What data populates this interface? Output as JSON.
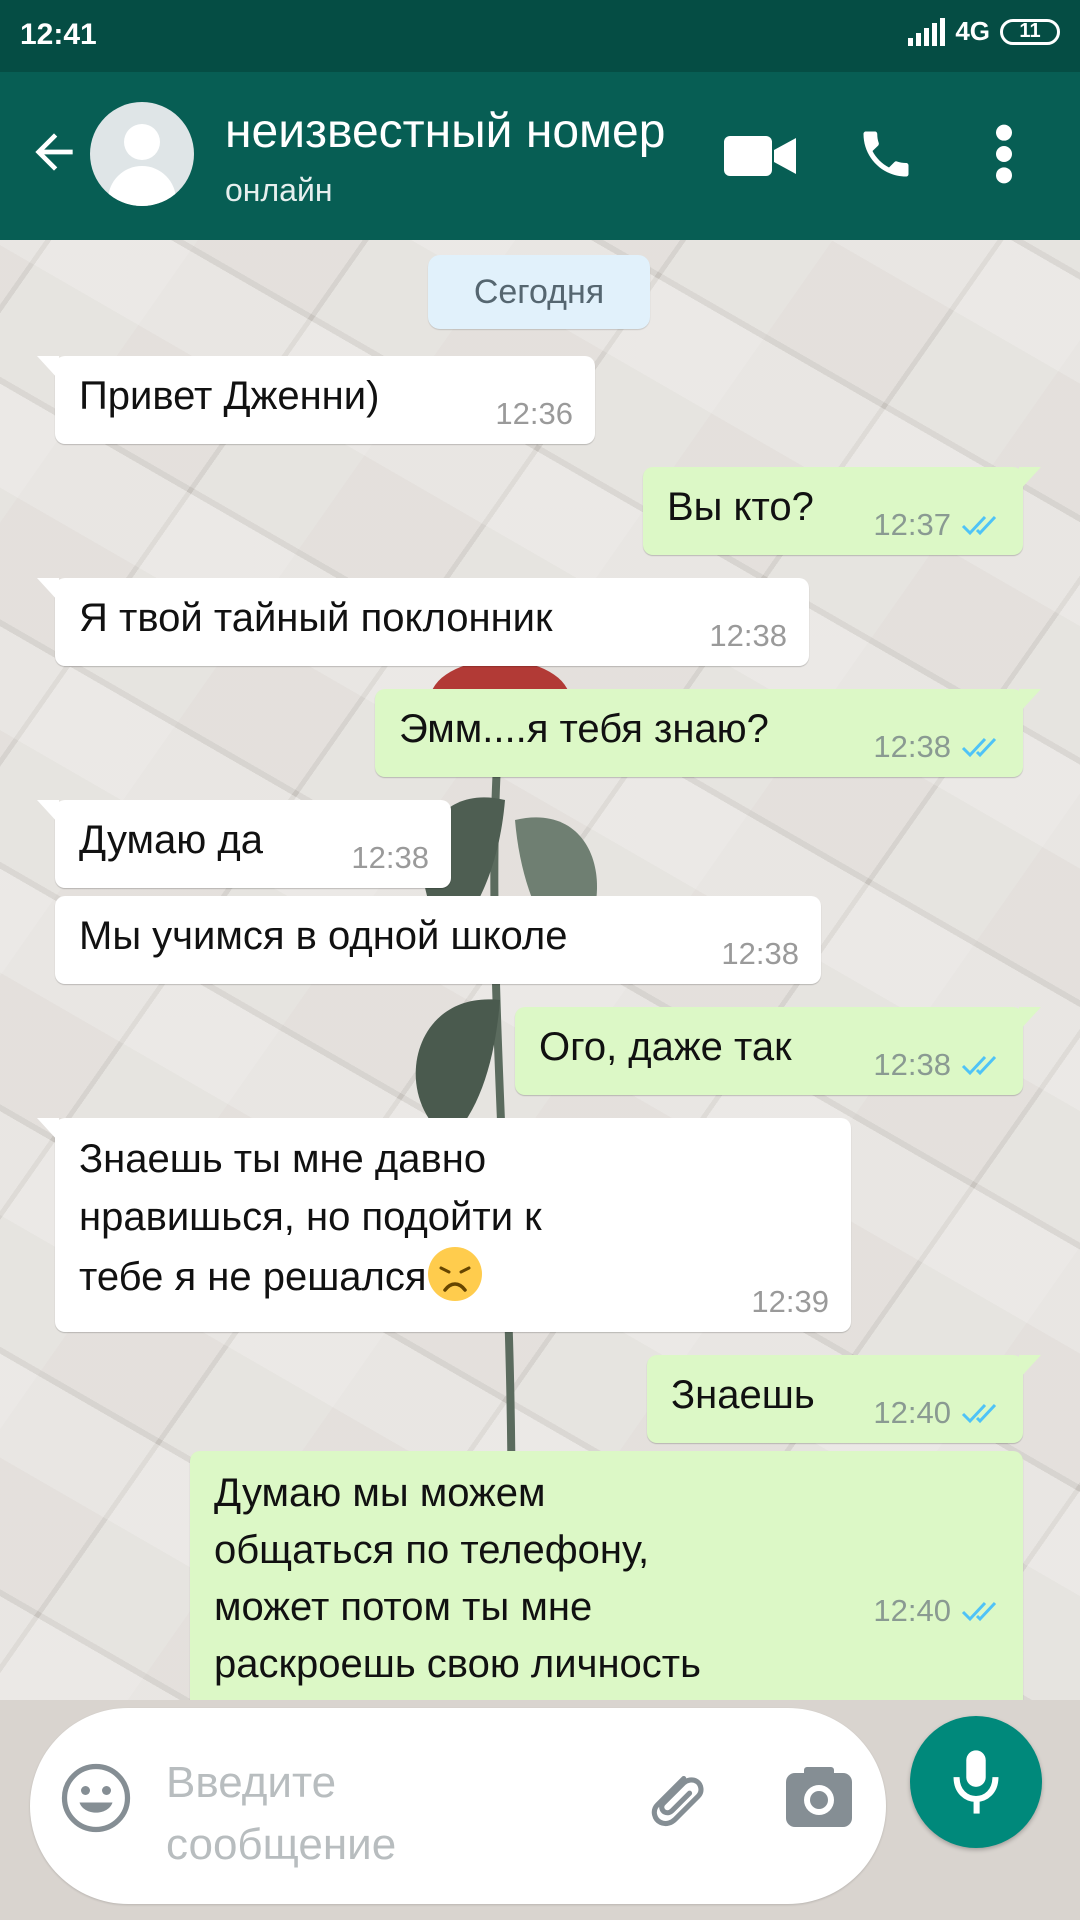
{
  "status_bar": {
    "time": "12:41",
    "network": "4G",
    "battery": "11"
  },
  "header": {
    "contact_name": "неизвестный номер",
    "contact_status": "онлайн",
    "icons": [
      "back-arrow-icon",
      "avatar",
      "video-call-icon",
      "phone-icon",
      "more-vert-icon"
    ]
  },
  "chat": {
    "date_label": "Сегодня",
    "messages": [
      {
        "direction": "in",
        "text": "Привет Дженни)",
        "time": "12:36"
      },
      {
        "direction": "out",
        "text": "Вы кто?",
        "time": "12:37"
      },
      {
        "direction": "in",
        "text": "Я твой тайный поклонник",
        "time": "12:38"
      },
      {
        "direction": "out",
        "text": "Эмм....я тебя знаю?",
        "time": "12:38"
      },
      {
        "direction": "in",
        "text": "Думаю да",
        "time": "12:38"
      },
      {
        "direction": "in",
        "text": "Мы учимся в одной школе",
        "time": "12:38"
      },
      {
        "direction": "out",
        "text": "Ого, даже так",
        "time": "12:38"
      },
      {
        "direction": "in",
        "text_lines": [
          "Знаешь ты мне давно",
          "нравишься, но подойти к",
          "тебе я не решался"
        ],
        "emoji": "disappointed-face-emoji",
        "time": "12:39"
      },
      {
        "direction": "out",
        "text": "Знаешь",
        "time": "12:40"
      },
      {
        "direction": "out",
        "text_lines": [
          "Думаю мы можем",
          "общаться по телефону,",
          "может потом ты мне",
          "раскроешь свою личность"
        ],
        "time": "12:40"
      }
    ]
  },
  "composer": {
    "placeholder_lines": [
      "Введите",
      "сообщение"
    ]
  },
  "colors": {
    "header": "#075e54",
    "status_bar": "#054d44",
    "outgoing_bubble": "#dcf8c6",
    "incoming_bubble": "#ffffff",
    "read_ticks": "#4fc3f7",
    "mic_button": "#00897b"
  }
}
